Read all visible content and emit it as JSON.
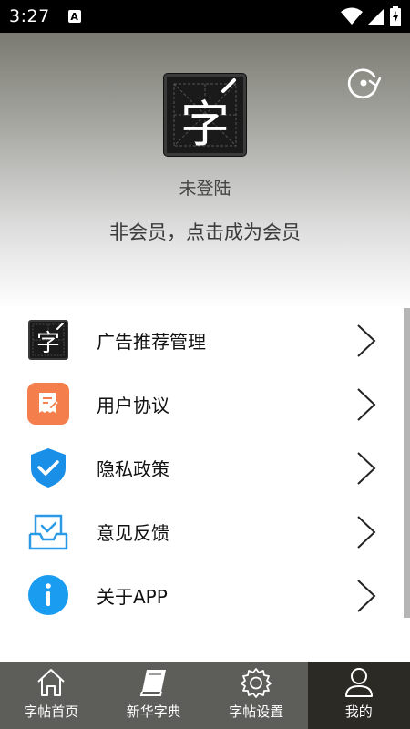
{
  "status_bar": {
    "time": "3:27",
    "notify_letter": "A"
  },
  "header": {
    "logo_char": "字",
    "login_status": "未登陆",
    "vip_prompt": "非会员，点击成为会员"
  },
  "menu": [
    {
      "label": "广告推荐管理",
      "icon": "logo-icon"
    },
    {
      "label": "用户协议",
      "icon": "document-icon",
      "color": "#f47f4c"
    },
    {
      "label": "隐私政策",
      "icon": "shield-check-icon",
      "color": "#1a8fe8"
    },
    {
      "label": "意见反馈",
      "icon": "inbox-icon",
      "color": "#2a9ae6"
    },
    {
      "label": "关于APP",
      "icon": "info-icon",
      "color": "#1a9cf0"
    }
  ],
  "bottom_nav": [
    {
      "label": "字帖首页",
      "icon": "home-icon"
    },
    {
      "label": "新华字典",
      "icon": "book-icon"
    },
    {
      "label": "字帖设置",
      "icon": "gear-icon"
    },
    {
      "label": "我的",
      "icon": "user-icon",
      "active": true
    }
  ]
}
